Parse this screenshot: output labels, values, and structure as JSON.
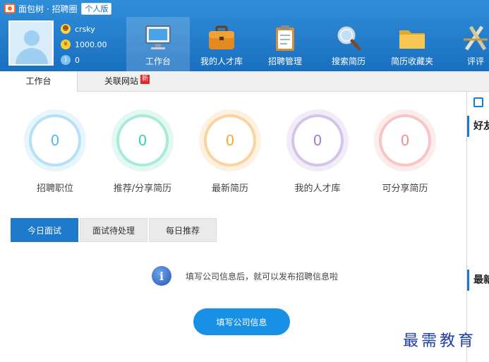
{
  "app": {
    "title": "面包树 · 招聘圈",
    "edition": "个人版"
  },
  "user": {
    "name": "crsky",
    "coins": "1000.00",
    "points": "0"
  },
  "nav": [
    {
      "label": "工作台",
      "icon": "monitor-icon",
      "active": true
    },
    {
      "label": "我的人才库",
      "icon": "briefcase-icon",
      "active": false
    },
    {
      "label": "招聘管理",
      "icon": "clipboard-icon",
      "active": false
    },
    {
      "label": "搜索简历",
      "icon": "magnifier-icon",
      "active": false
    },
    {
      "label": "简历收藏夹",
      "icon": "folder-icon",
      "active": false
    },
    {
      "label": "评评",
      "icon": "ruler-icon",
      "active": false
    }
  ],
  "tabs": {
    "workbench": "工作台",
    "related_sites": "关联网站",
    "new_badge": "新"
  },
  "stats": [
    {
      "label": "招聘职位",
      "value": "0",
      "color": "#55b9ee"
    },
    {
      "label": "推荐/分享简历",
      "value": "0",
      "color": "#3fd1b0"
    },
    {
      "label": "最新简历",
      "value": "0",
      "color": "#f7a83c"
    },
    {
      "label": "我的人才库",
      "value": "0",
      "color": "#a27cd0"
    },
    {
      "label": "可分享简历",
      "value": "0",
      "color": "#f28f91"
    }
  ],
  "subtabs": [
    "今日面试",
    "面试待处理",
    "每日推荐"
  ],
  "notice": "填写公司信息后，就可以发布招聘信息啦",
  "fill_button": "填写公司信息",
  "right_panel": {
    "title1": "好友",
    "title2": "最新"
  },
  "watermark": "最需教育",
  "colors": {
    "header": "#1a6fc0",
    "accent": "#1890e6"
  }
}
